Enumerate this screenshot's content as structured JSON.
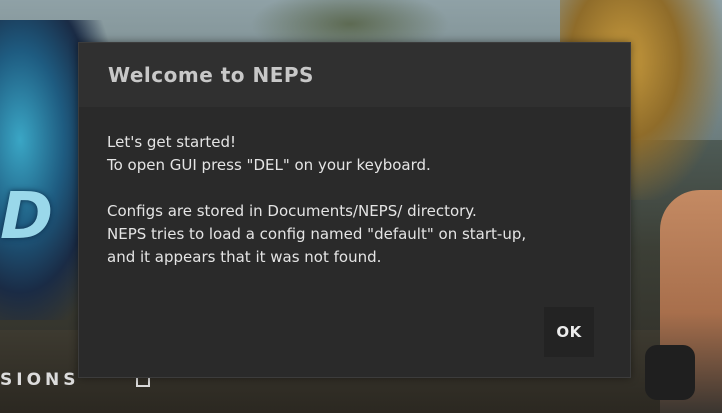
{
  "background": {
    "menu_text": "SIONS",
    "menu_icon": "external-link-icon"
  },
  "dialog": {
    "title": "Welcome to NEPS",
    "lines": [
      "Let's get started!",
      "To open GUI press \"DEL\" on your keyboard.",
      "",
      "Configs are stored in Documents/NEPS/ directory.",
      "NEPS tries to load a config named \"default\" on start-up,",
      "and it appears that it was not found."
    ],
    "ok_label": "OK"
  },
  "colors": {
    "dialog_bg": "#2a2a2a",
    "header_bg": "#303030",
    "title_text": "#c8c8c8",
    "body_text": "#e4e4e4",
    "button_bg": "#232323"
  }
}
